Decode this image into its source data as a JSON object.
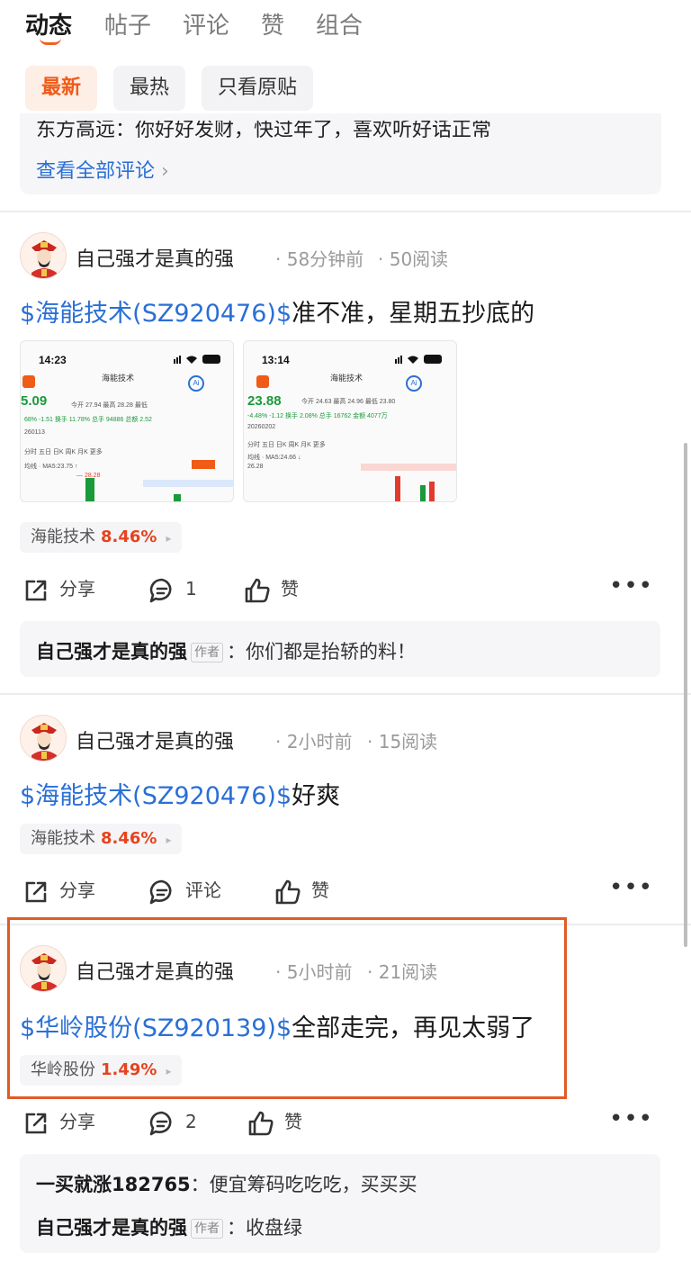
{
  "tabs": [
    {
      "label": "动态",
      "active": true
    },
    {
      "label": "帖子",
      "active": false
    },
    {
      "label": "评论",
      "active": false
    },
    {
      "label": "赞",
      "active": false
    },
    {
      "label": "组合",
      "active": false
    }
  ],
  "filters": [
    {
      "label": "最新",
      "active": true
    },
    {
      "label": "最热",
      "active": false
    },
    {
      "label": "只看原贴",
      "active": false
    }
  ],
  "prev_post": {
    "cut_comment": "东方高远：你好好发财，快过年了，喜欢听好话正常",
    "view_all": "查看全部评论",
    "view_all_arrow": "›"
  },
  "icons": {
    "share": "share-icon",
    "comment": "comment-icon",
    "like": "thumbs-up-icon",
    "more": "more-icon",
    "avatar": "caishen-avatar"
  },
  "posts": [
    {
      "author": "自己强才是真的强",
      "time": "· 58分钟前",
      "reads": "· 50阅读",
      "stock_link": "$海能技术(SZ920476)$",
      "text": "准不准，星期五抄底的",
      "tag_name": "海能技术",
      "tag_pct": "8.46%",
      "tag_arrow": "▸",
      "share": "分享",
      "comment": "1",
      "like": "赞",
      "more": "•••",
      "replies": [
        {
          "name": "自己强才是真的强",
          "badge": "作者",
          "text": "：你们都是抬轿的料！"
        }
      ],
      "images": [
        {
          "time": "14:23",
          "title": "海能技术",
          "price": "5.09",
          "row1": "今开 27.94 最高 28.28 最低",
          "row2": "68% -1.51 换手 11.78% 总手 94886 总额 2.52",
          "row3": "260113",
          "row4": "分时 五日 日K 周K 月K 更多",
          "row5": "均线 · MA5:23.75 ↑",
          "row6": "— 28.28"
        },
        {
          "time": "13:14",
          "title": "海能技术",
          "price": "23.88",
          "row1": "今开 24.63 最高 24.96 最低 23.80",
          "row2": "-4.48% -1.12 换手 2.08% 总手 16762 金额 4077万",
          "row3": "20260202",
          "row4": "分时 五日 日K 周K 月K 更多",
          "row5": "均线 · MA5:24.66 ↓",
          "row6": "26.28"
        }
      ]
    },
    {
      "author": "自己强才是真的强",
      "time": "· 2小时前",
      "reads": "· 15阅读",
      "stock_link": "$海能技术(SZ920476)$",
      "text": "好爽",
      "tag_name": "海能技术",
      "tag_pct": "8.46%",
      "tag_arrow": "▸",
      "share": "分享",
      "comment": "评论",
      "like": "赞",
      "more": "•••"
    },
    {
      "author": "自己强才是真的强",
      "time": "· 5小时前",
      "reads": "· 21阅读",
      "stock_link": "$华岭股份(SZ920139)$",
      "text": "全部走完，再见太弱了",
      "tag_name": "华岭股份",
      "tag_pct": "1.49%",
      "tag_arrow": "▸",
      "share": "分享",
      "comment": "2",
      "like": "赞",
      "more": "•••",
      "replies": [
        {
          "name": "一买就涨182765",
          "badge": "",
          "text": "：便宜筹码吃吃吃，买买买"
        },
        {
          "name": "自己强才是真的强",
          "badge": "作者",
          "text": "：收盘绿"
        }
      ]
    }
  ],
  "colors": {
    "accent": "#f05b17",
    "link": "#2a6fd6",
    "up_pct": "#e6431e",
    "highlight_box": "#e25b25"
  }
}
